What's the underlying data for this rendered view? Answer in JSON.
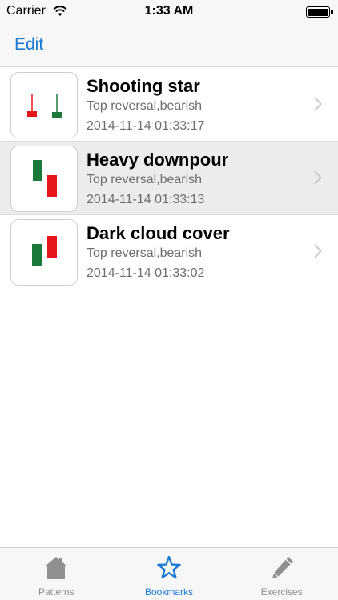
{
  "status_bar": {
    "carrier": "Carrier",
    "time": "1:33 AM"
  },
  "nav_bar": {
    "edit_label": "Edit"
  },
  "bookmarks": [
    {
      "title": "Shooting star",
      "subtitle": "Top reversal,bearish",
      "date": "2014-11-14 01:33:17",
      "selected": false,
      "icon": "shooting-star-pattern-icon"
    },
    {
      "title": "Heavy downpour",
      "subtitle": "Top reversal,bearish",
      "date": "2014-11-14 01:33:13",
      "selected": true,
      "icon": "heavy-downpour-pattern-icon"
    },
    {
      "title": "Dark cloud cover",
      "subtitle": "Top reversal,bearish",
      "date": "2014-11-14 01:33:02",
      "selected": false,
      "icon": "dark-cloud-cover-pattern-icon"
    }
  ],
  "tabs": [
    {
      "label": "Patterns",
      "icon": "house-icon",
      "active": false
    },
    {
      "label": "Bookmarks",
      "icon": "star-icon",
      "active": true
    },
    {
      "label": "Exercises",
      "icon": "pencil-icon",
      "active": false
    }
  ],
  "colors": {
    "accent": "#1b7bd4",
    "bearish_red": "#e8141c",
    "bullish_green": "#1a7a3c",
    "selected_row": "#ececec"
  }
}
